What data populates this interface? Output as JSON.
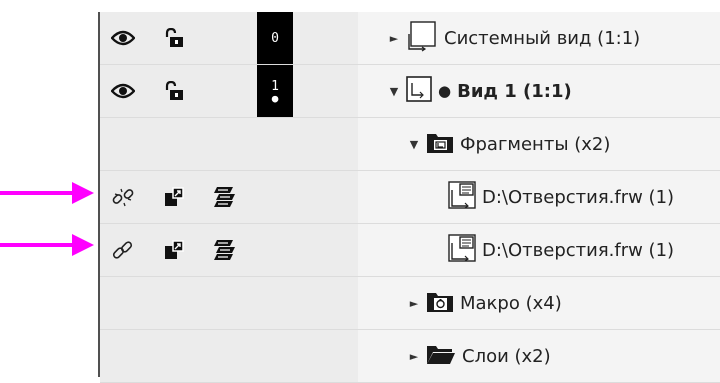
{
  "layers": {
    "row0": {
      "number": "0",
      "dot": ""
    },
    "row1": {
      "number": "1",
      "dot": "●"
    }
  },
  "tree": {
    "system_view": "Системный вид (1:1)",
    "view1": "Вид 1 (1:1)",
    "fragments": "Фрагменты (x2)",
    "frag1": "D:\\Отверстия.frw (1)",
    "frag2": "D:\\Отверстия.frw (1)",
    "macro": "Макро (x4)",
    "layers": "Слои (x2)"
  },
  "toggles": {
    "collapsed": "►",
    "expanded": "▼"
  },
  "icons": {
    "visibility": "eye-icon",
    "lock": "lock-open-icon",
    "link_broken": "broken-link-icon",
    "link": "link-icon",
    "insert": "insert-fragment-icon",
    "layers": "layers-icon",
    "view": "view-icon",
    "folder": "folder-icon",
    "macro": "macro-icon",
    "fragment": "fragment-file-icon"
  },
  "colors": {
    "annotation_arrow": "#ff00ff",
    "panel_left": "#ececec",
    "panel_right": "#f4f4f4"
  }
}
